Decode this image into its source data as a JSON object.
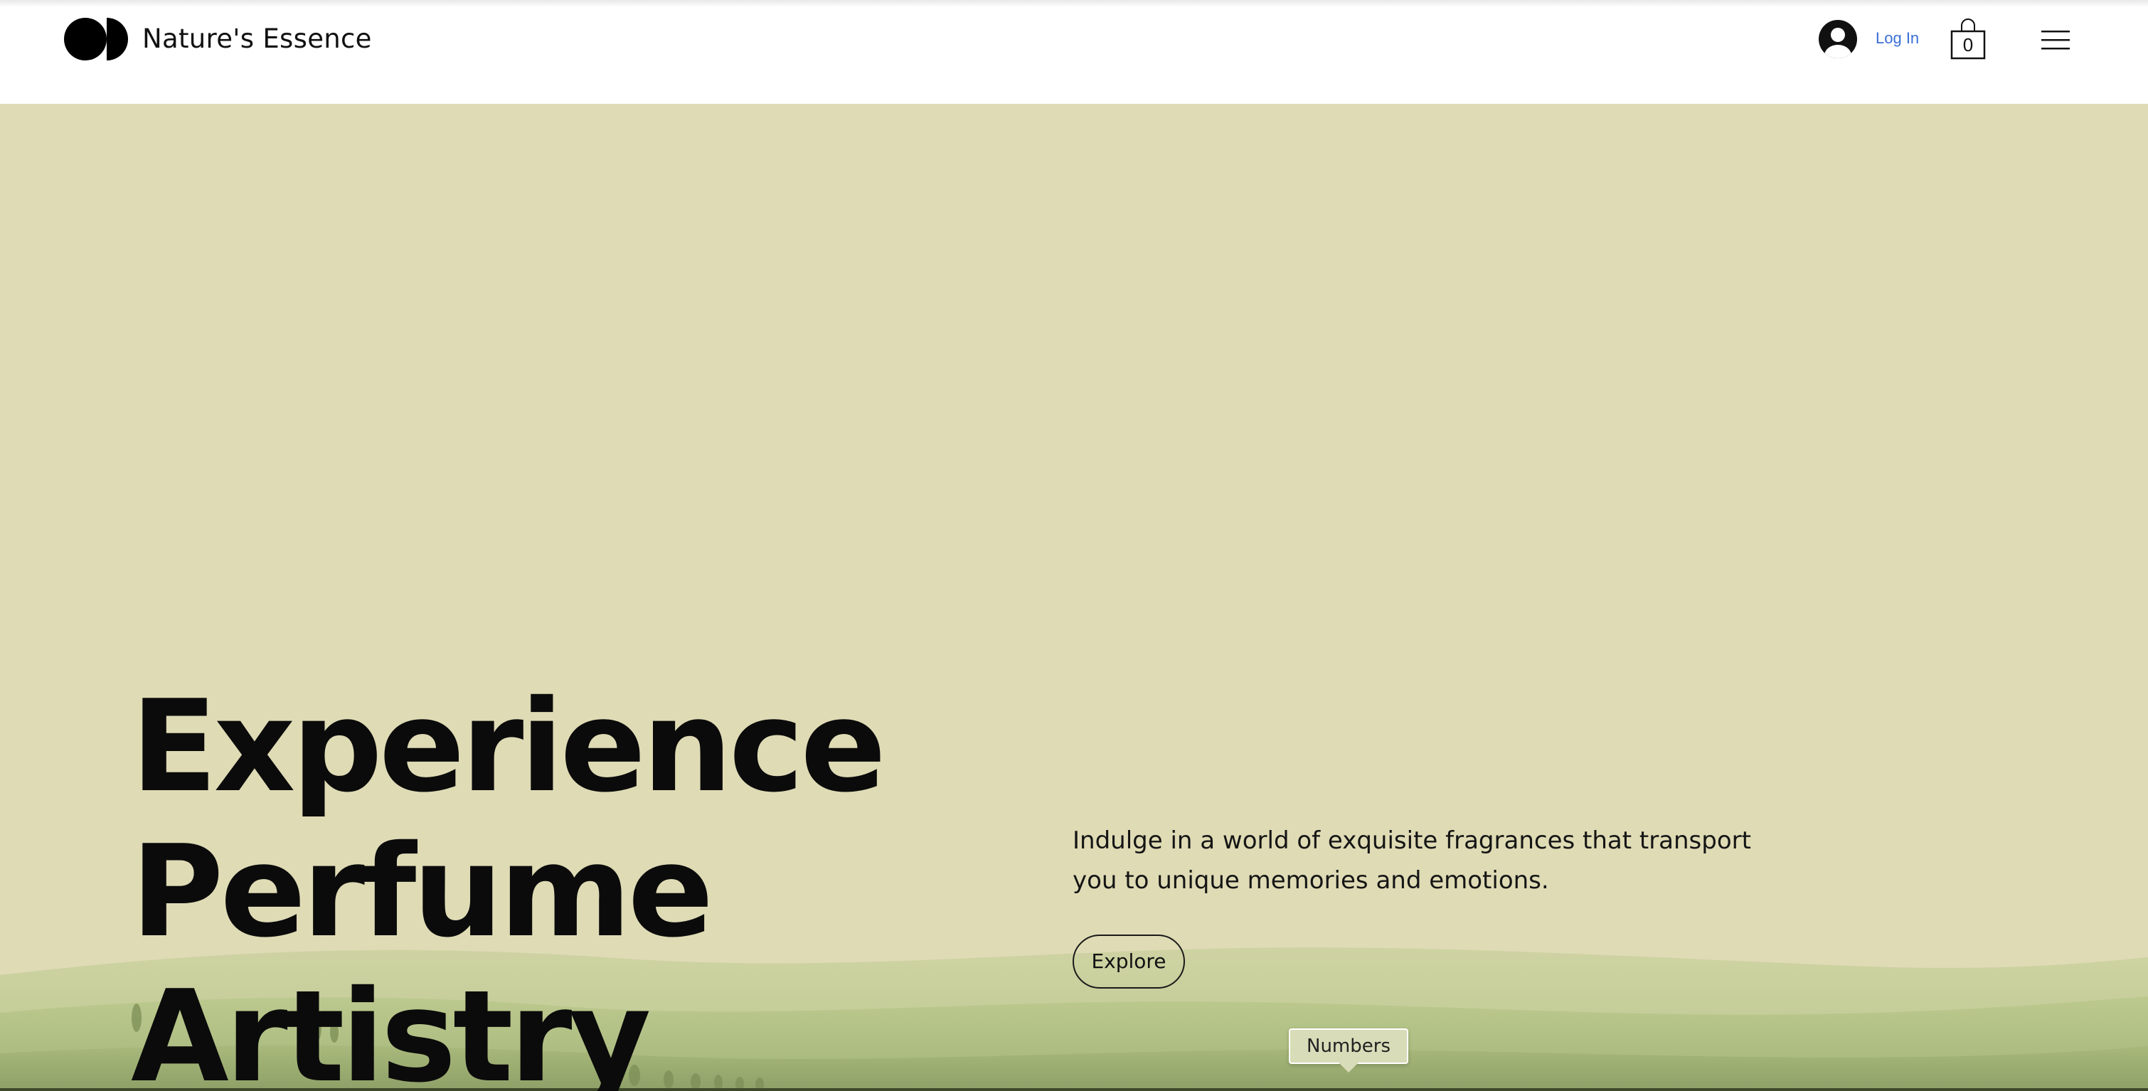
{
  "header": {
    "brand": "Nature's Essence",
    "login_label": "Log In",
    "cart_count": "0"
  },
  "hero": {
    "headline": [
      "Experience",
      "Perfume",
      "Artistry"
    ],
    "description": "Indulge in a world of exquisite fragrances that transport you to unique memories and emotions.",
    "explore_label": "Explore",
    "tooltip": "Numbers"
  },
  "icons": {
    "logo": "half-circles-logo-icon",
    "avatar": "user-avatar-icon",
    "cart": "shopping-bag-icon",
    "menu": "hamburger-menu-icon"
  },
  "colors": {
    "hero_background": "#dfdbb5",
    "login_link": "#3b6fd6",
    "text": "#0b0b0b"
  }
}
